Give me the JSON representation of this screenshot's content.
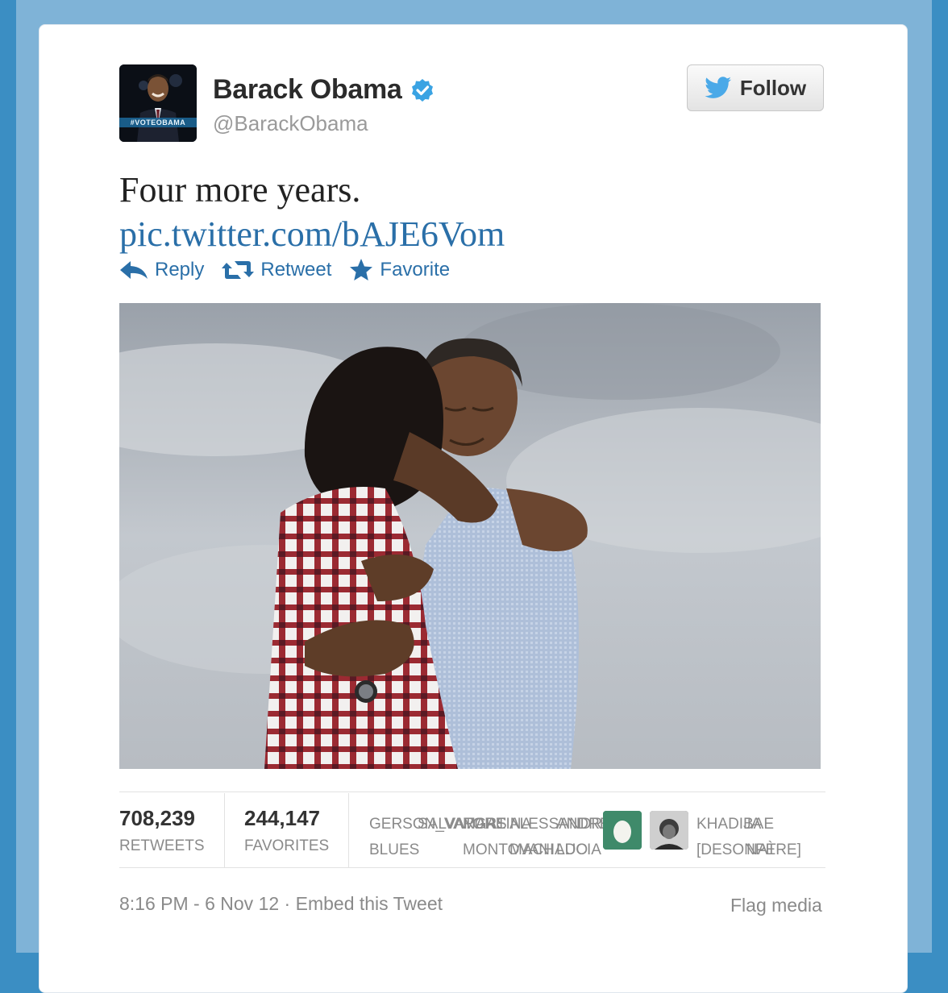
{
  "user": {
    "name": "Barack Obama",
    "handle": "@BarackObama",
    "avatar_caption": "#VOTEOBAMA"
  },
  "follow_button": {
    "label": "Follow",
    "icon": "twitter-bird-icon"
  },
  "tweet": {
    "text": "Four more years.",
    "link": "pic.twitter.com/bAJE6Vom"
  },
  "actions": [
    {
      "label": "Reply",
      "icon": "reply-icon"
    },
    {
      "label": "Retweet",
      "icon": "retweet-icon"
    },
    {
      "label": "Favorite",
      "icon": "star-icon"
    }
  ],
  "stats": {
    "retweets": {
      "value": "708,239",
      "label": "RETWEETS"
    },
    "favorites": {
      "value": "244,147",
      "label": "FAVORITES"
    }
  },
  "favoriters": [
    {
      "line1": "GERSON_VARGAS",
      "line2": "BLUES"
    },
    {
      "line1": "SALVATORE",
      "line2": ""
    },
    {
      "line1": "MARTINA",
      "line2": "MONTOVANI"
    },
    {
      "line1": "ALESSANDRA",
      "line2": "MACHADO"
    },
    {
      "line1": "ANDREA",
      "line2": "LUCIA"
    },
    {
      "line1": "KHADIJA",
      "line2": "[DESONPÈRE]"
    },
    {
      "line1": "BAE",
      "line2": "NAT"
    }
  ],
  "footer": {
    "timestamp": "8:16 PM - 6 Nov 12",
    "separator": "·",
    "embed": "Embed this Tweet",
    "flag": "Flag media"
  },
  "colors": {
    "background": "#3b8ec3",
    "link": "#2a6fa8",
    "verified": "#3aa3e3"
  }
}
